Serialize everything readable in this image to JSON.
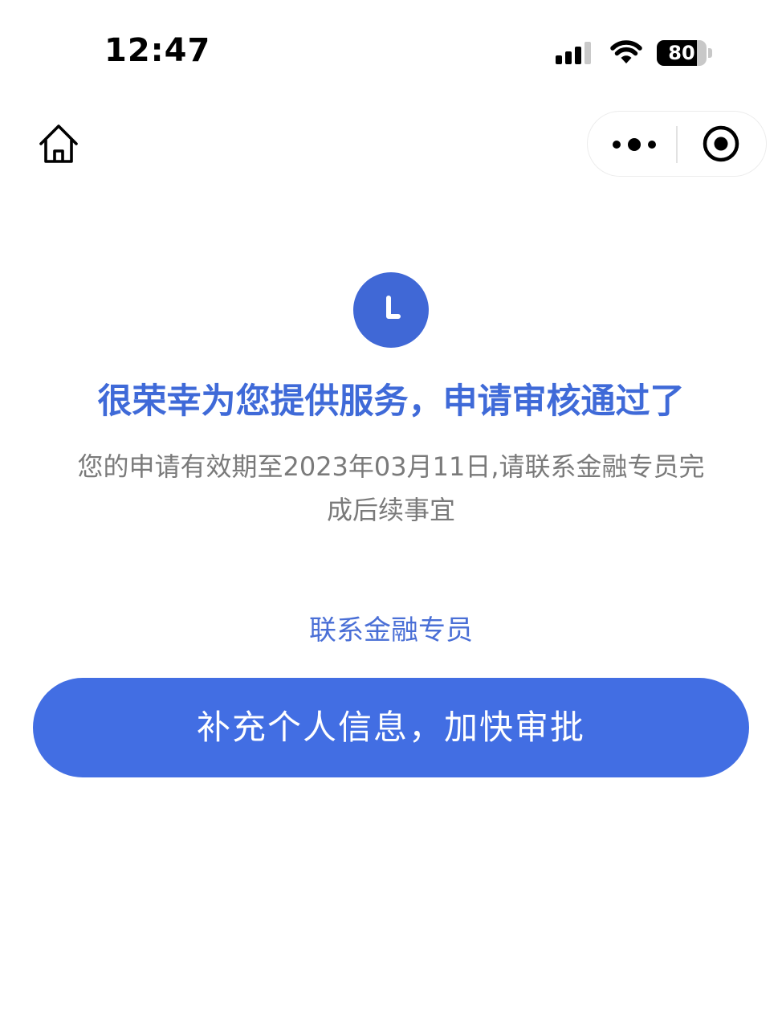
{
  "status_bar": {
    "time": "12:47",
    "battery_level": "80",
    "battery_fraction": 0.8,
    "signal_bars_active": 3,
    "signal_bars_total": 4
  },
  "nav": {
    "home_icon": "home-icon",
    "more_icon": "more-dots-icon",
    "close_icon": "target-circle-icon"
  },
  "main": {
    "status_icon": "clock-icon",
    "title": "很荣幸为您提供服务，申请审核通过了",
    "description": "您的申请有效期至2023年03月11日,请联系金融专员完成后续事宜",
    "contact_link": "联系金融专员",
    "primary_button": "补充个人信息，加快审批"
  },
  "colors": {
    "accent": "#426ee3",
    "title": "#3f6ad8",
    "link": "#4a6fd6",
    "text_secondary": "#7a7a7a"
  }
}
